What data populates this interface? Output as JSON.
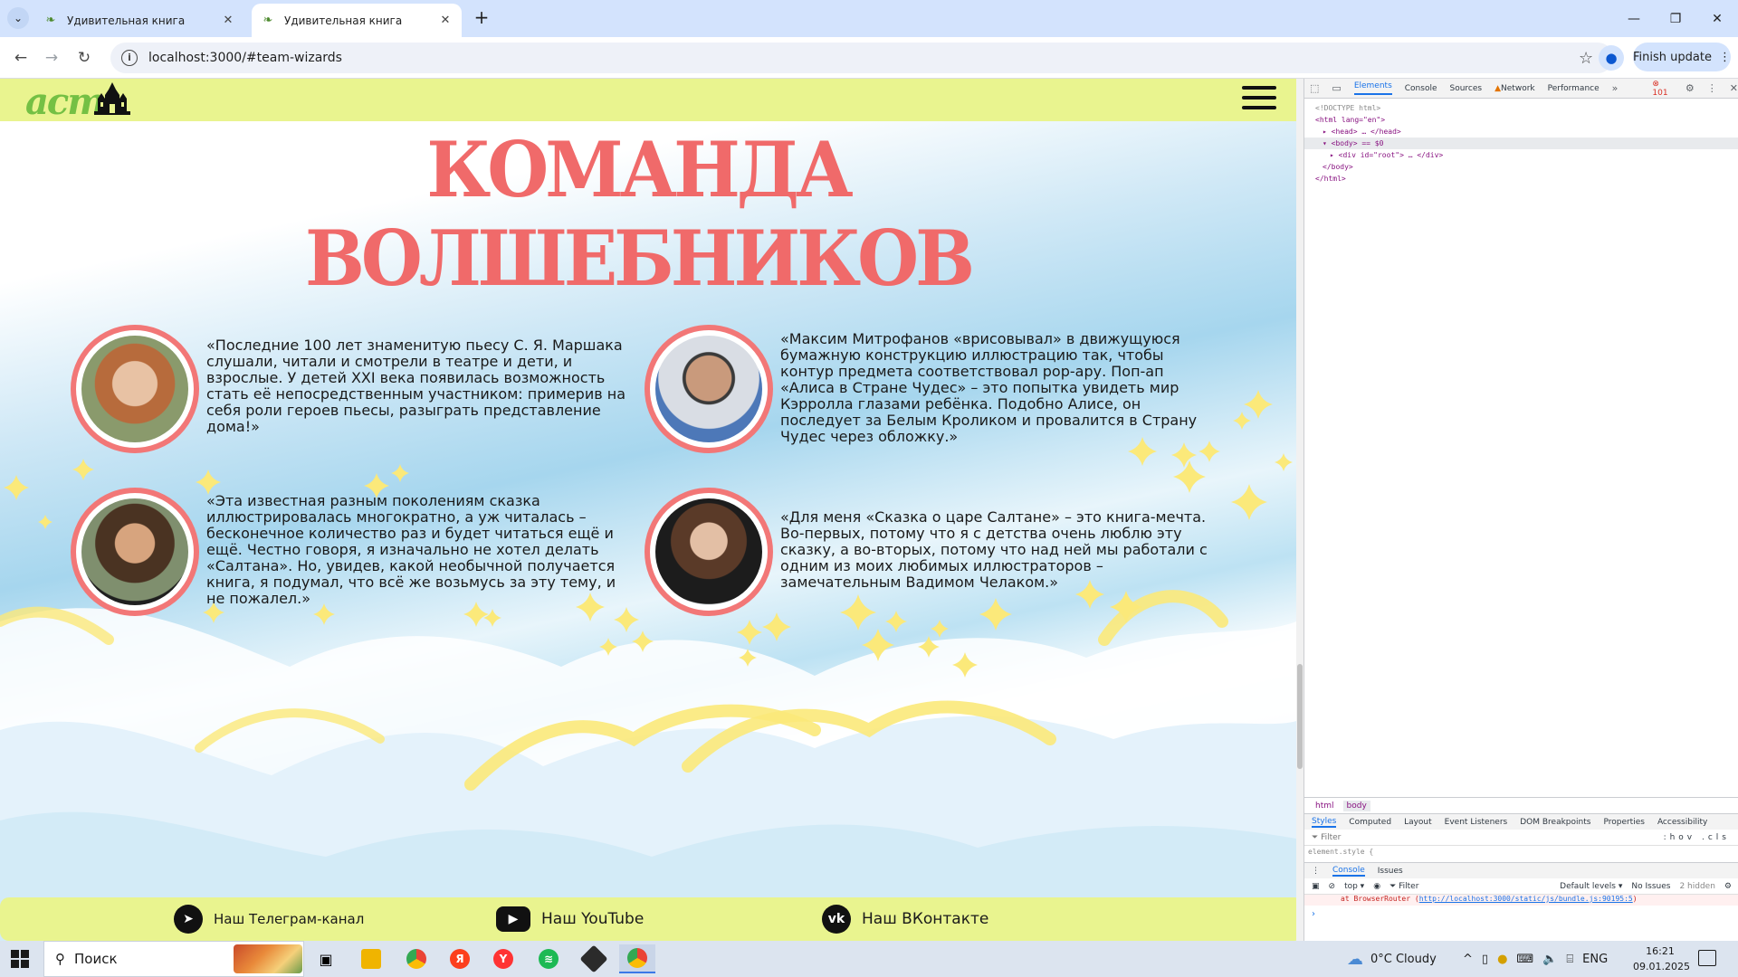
{
  "browser": {
    "tabs": [
      {
        "title": "Удивительная книга",
        "active": false
      },
      {
        "title": "Удивительная книга",
        "active": true
      }
    ],
    "url": "localhost:3000/#team-wizards",
    "finish_update_label": "Finish update"
  },
  "site": {
    "logo_text": "аст",
    "page_title": "КОМАНДА ВОЛШЕБНИКОВ",
    "team": [
      {
        "quote": "«Последние 100 лет знаменитую пьесу С. Я. Маршака слушали, читали и смотрели в театре и дети, и взрослые. У детей XXI века появилась возможность стать её непосредственным участником: примерив на себя роли героев пьесы, разыграть представление дома!»"
      },
      {
        "quote": "«Максим Митрофанов «врисовывал» в движущуюся бумажную конструкцию иллюстрацию так, чтобы контур предмета соответствовал pop-ару. Поп-ап «Алиса в Стране Чудес» – это попытка увидеть мир Кэрролла глазами ребёнка. Подобно Алисе, он последует за Белым Кроликом и провалится в Страну Чудес через обложку.»"
      },
      {
        "quote": "«Эта известная разным поколениям сказка иллюстрировалась многократно, а уж читалась – бесконечное количество раз и будет читаться ещё и ещё. Честно говоря, я изначально не хотел делать «Салтана». Но, увидев, какой необычной получается книга, я подумал, что всё же возьмусь за эту тему, и не пожалел.»"
      },
      {
        "quote": "«Для меня «Сказка о царе Салтане» – это книга-мечта. Во-первых, потому что я с детства очень люблю эту сказку, а во-вторых, потому что над ней мы работали с одним из моих любимых иллюстраторов – замечательным Вадимом Челаком.»"
      }
    ],
    "footer": {
      "telegram": "Наш Телеграм-канал",
      "youtube": "Наш YouTube",
      "vk": "Наш ВКонтакте"
    },
    "colors": {
      "header_bg": "#e9f48f",
      "title": "#f06a6a",
      "avatar_ring": "#f27777",
      "star": "#fbe97a"
    }
  },
  "devtools": {
    "tabs": [
      "Elements",
      "Console",
      "Sources",
      "Network",
      "Performance"
    ],
    "active_tab": "Elements",
    "error_count": "101",
    "tree": {
      "doctype": "<!DOCTYPE html>",
      "html_open": "<html lang=\"en\">",
      "head": "<head> … </head>",
      "body_open": "<body> == $0",
      "root_div": "<div id=\"root\"> … </div>",
      "body_close": "</body>",
      "html_close": "</html>"
    },
    "breadcrumbs": [
      "html",
      "body"
    ],
    "style_tabs": [
      "Styles",
      "Computed",
      "Layout",
      "Event Listeners",
      "DOM Breakpoints",
      "Properties",
      "Accessibility"
    ],
    "filter_placeholder": "Filter",
    "filter_tools": ":hov .cls",
    "element_style": "element.style {",
    "drawer_tabs": [
      "Console",
      "Issues"
    ],
    "console_context": "top",
    "console_filter": "Filter",
    "default_levels": "Default levels",
    "no_issues": "No Issues",
    "hidden_count": "2 hidden",
    "error_line_prefix": "at BrowserRouter (",
    "error_line_link": "http://localhost:3000/static/js/bundle.js:90195:5",
    "error_line_suffix": ")"
  },
  "taskbar": {
    "search_label": "Поиск",
    "weather": "0°C  Cloudy",
    "language": "ENG",
    "time": "16:21",
    "date": "09.01.2025"
  }
}
